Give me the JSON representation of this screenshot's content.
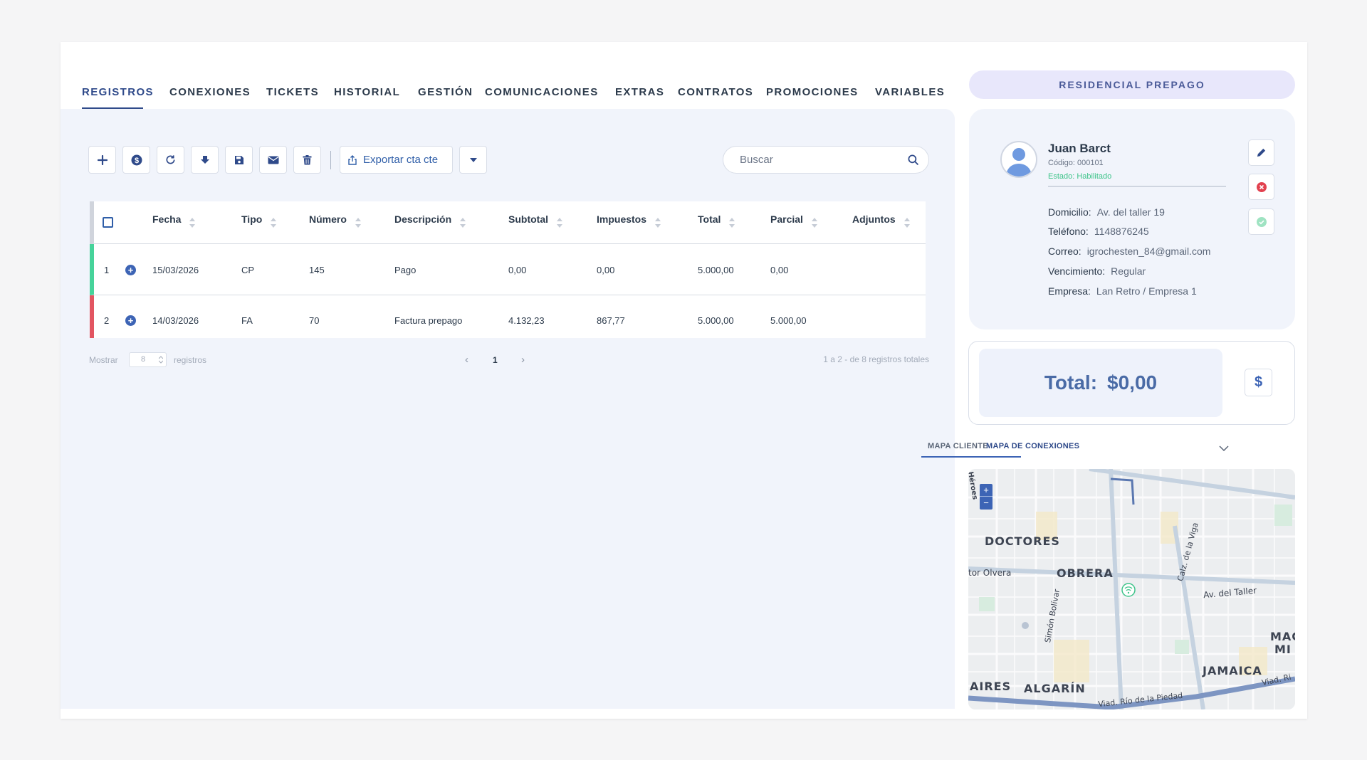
{
  "tabs": [
    {
      "label": "REGISTROS",
      "active": true
    },
    {
      "label": "CONEXIONES"
    },
    {
      "label": "TICKETS"
    },
    {
      "label": "HISTORIAL"
    },
    {
      "label": "GESTIÓN"
    },
    {
      "label": "COMUNICACIONES"
    },
    {
      "label": "EXTRAS"
    },
    {
      "label": "CONTRATOS"
    },
    {
      "label": "PROMOCIONES"
    },
    {
      "label": "VARIABLES"
    }
  ],
  "toolbar": {
    "buttons": [
      "plus-icon",
      "dollar-coin-icon",
      "refresh-icon",
      "download-icon",
      "save-icon",
      "mail-icon",
      "trash-icon"
    ],
    "export_label": "Exportar cta cte"
  },
  "search": {
    "placeholder": "Buscar"
  },
  "table": {
    "headers": [
      "Fecha",
      "Tipo",
      "Número",
      "Descripción",
      "Subtotal",
      "Impuestos",
      "Total",
      "Parcial",
      "Adjuntos"
    ],
    "rows": [
      {
        "n": "1",
        "fecha": "15/03/2026",
        "tipo": "CP",
        "numero": "145",
        "descripcion": "Pago",
        "subtotal": "0,00",
        "impuestos": "0,00",
        "total": "5.000,00",
        "parcial": "0,00",
        "adjuntos": "",
        "status_color": "#46d39a"
      },
      {
        "n": "2",
        "fecha": "14/03/2026",
        "tipo": "FA",
        "numero": "70",
        "descripcion": "Factura prepago",
        "subtotal": "4.132,23",
        "impuestos": "867,77",
        "total": "5.000,00",
        "parcial": "5.000,00",
        "adjuntos": "",
        "status_color": "#e25561"
      }
    ]
  },
  "pager": {
    "show_label": "Mostrar",
    "page_size": "8",
    "records_label": "registros",
    "current_page": "1",
    "totals": "1 a 2 - de 8 registros totales"
  },
  "plan": {
    "label": "RESIDENCIAL PREPAGO"
  },
  "client": {
    "name": "Juan Barct",
    "code": "Código: 000101",
    "state": "Estado: Habilitado",
    "fields": [
      {
        "label": "Domicilio:",
        "value": "Av. del taller 19"
      },
      {
        "label": "Teléfono:",
        "value": "1148876245"
      },
      {
        "label": "Correo:",
        "value": "igrochesten_84@gmail.com"
      },
      {
        "label": "Vencimiento:",
        "value": "Regular"
      },
      {
        "label": "Empresa:",
        "value": "Lan Retro / Empresa 1"
      }
    ]
  },
  "total": {
    "label": "Total:",
    "value": "$0,00",
    "button": "$"
  },
  "map_tabs": [
    {
      "label": "MAPA CLIENTE"
    },
    {
      "label": "MAPA DE CONEXIONES",
      "active": true
    }
  ],
  "map": {
    "zoom_in": "+",
    "zoom_out": "−",
    "labels": {
      "doctores": "DOCTORES",
      "obrera": "OBRERA",
      "olvera": "tor Olvera",
      "bolivar": "Simón Bolívar",
      "viga": "Calz. de la Viga",
      "taller": "Av. del Taller",
      "jamaica": "JAMAICA",
      "aires": "AIRES",
      "algarin": "ALGARÍN",
      "piedad": "Viad. Río de la Piedad",
      "vrio": "Viad. Ri",
      "mac": "MAC",
      "mi": "MI",
      "heroes": "Héroes"
    }
  }
}
